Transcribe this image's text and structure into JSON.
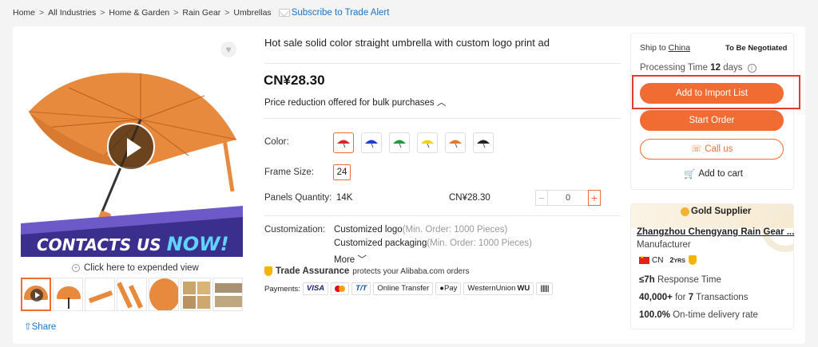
{
  "breadcrumb": {
    "items": [
      "Home",
      "All Industries",
      "Home & Garden",
      "Rain Gear",
      "Umbrellas"
    ],
    "separator": ">",
    "subscribe_label": "Subscribe to Trade Alert"
  },
  "gallery": {
    "banner_text_1": "CONTACTS US",
    "banner_text_2": "NOW!",
    "expand_label": "Click here to expended view",
    "thumbnail_count": 7,
    "share_label": "Share",
    "accent": "#f06c32"
  },
  "product": {
    "title": "Hot sale solid color straight umbrella with custom logo print ad",
    "price": "CN¥28.30",
    "bulk_note": "Price reduction offered for bulk purchases",
    "color_label": "Color:",
    "colors": [
      "#d8262b",
      "#1f3ed1",
      "#1f9a3c",
      "#f2d31b",
      "#e57a2a",
      "#222222"
    ],
    "frame_size_label": "Frame Size:",
    "frame_size_value": "24",
    "panels_label": "Panels Quantity:",
    "panels_value": "14K",
    "panels_price": "CN¥28.30",
    "quantity": "0",
    "customization_label": "Customization:",
    "custom_logo": "Customized logo",
    "custom_logo_moq": "(Min. Order: 1000 Pieces)",
    "custom_packaging": "Customized packaging",
    "custom_packaging_moq": "(Min. Order: 1000 Pieces)",
    "more_label": "More",
    "trade_assurance": "Trade Assurance",
    "trade_assurance_note": "protects your Alibaba.com orders",
    "payments_label": "Payments:",
    "payments": [
      "VISA",
      "T/T",
      "Online Transfer",
      "Pay",
      "WesternUnion",
      "WU"
    ]
  },
  "order_panel": {
    "ship_to_label": "Ship to",
    "ship_to_country": "China",
    "shipping_cost": "To Be Negotiated",
    "processing_label": "Processing Time",
    "processing_days": "12",
    "processing_unit": "days",
    "add_import": "Add to Import List",
    "start_order": "Start Order",
    "call_us": "Call us",
    "add_cart": "Add to cart"
  },
  "supplier": {
    "badge": "Gold Supplier",
    "name": "Zhangzhou Chengyang Rain Gear ...",
    "type": "Manufacturer",
    "country": "CN",
    "years": "2",
    "years_unit": "YRS",
    "response_value": "≤7h",
    "response_label": "Response Time",
    "transactions_value": "40,000+",
    "transactions_mid": "for",
    "transactions_count": "7",
    "transactions_label": "Transactions",
    "ontime_value": "100.0%",
    "ontime_label": "On-time delivery rate"
  }
}
